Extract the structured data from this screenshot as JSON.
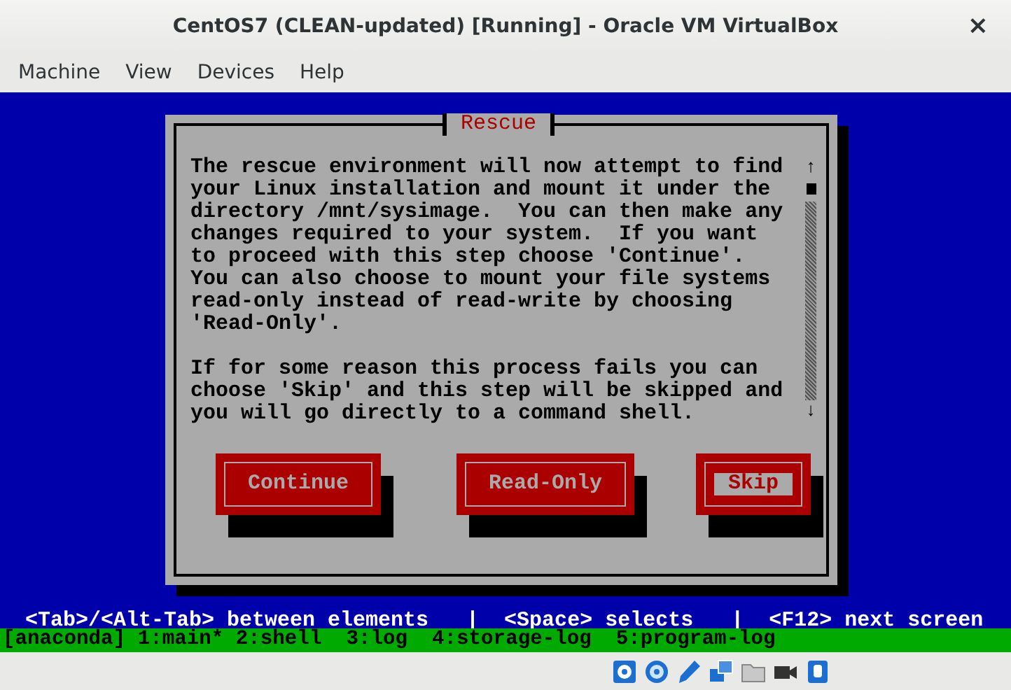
{
  "window": {
    "title": "CentOS7 (CLEAN-updated) [Running] - Oracle VM VirtualBox",
    "close": "×"
  },
  "menu": [
    "Machine",
    "View",
    "Devices",
    "Help"
  ],
  "dialog": {
    "title": "Rescue",
    "paragraphs": [
      [
        "The rescue environment will now attempt to find",
        "your Linux installation and mount it under the",
        "directory /mnt/sysimage.  You can then make any",
        "changes required to your system.  If you want",
        "to proceed with this step choose 'Continue'.",
        "You can also choose to mount your file systems",
        "read-only instead of read-write by choosing",
        "'Read-Only'."
      ],
      [
        "If for some reason this process fails you can",
        "choose 'Skip' and this step will be skipped and",
        "you will go directly to a command shell."
      ]
    ],
    "scrollbar": {
      "up": "↑",
      "down": "↓"
    },
    "buttons": [
      {
        "label": "Continue",
        "selected": false
      },
      {
        "label": "Read-Only",
        "selected": false
      },
      {
        "label": "Skip",
        "selected": true
      }
    ]
  },
  "help_line": "<Tab>/<Alt-Tab> between elements   |  <Space> selects   |  <F12> next screen",
  "tmux_bar": "[anaconda] 1:main* 2:shell  3:log  4:storage-log  5:program-log"
}
